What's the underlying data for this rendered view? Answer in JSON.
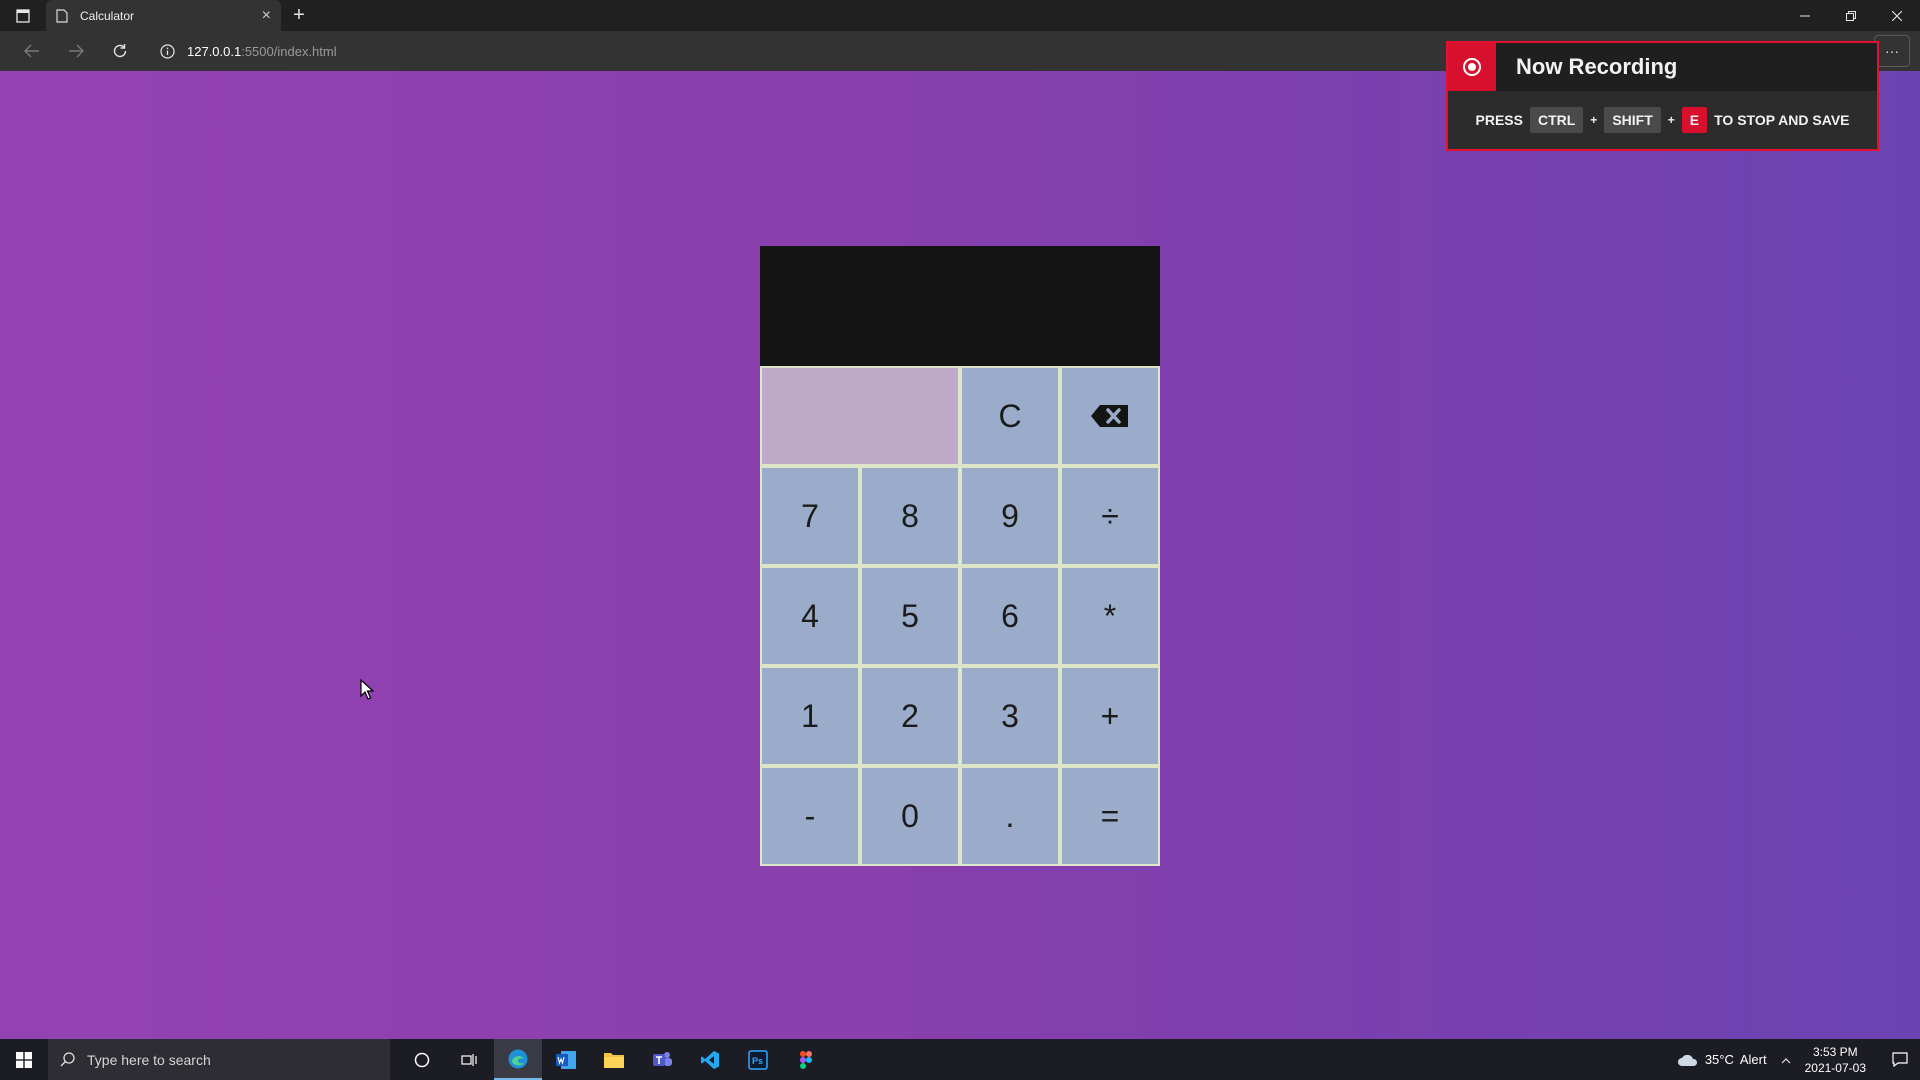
{
  "browser": {
    "tab_title": "Calculator",
    "tab_close": "×",
    "new_tab": "+",
    "url_host": "127.0.0.1",
    "url_path": ":5500/index.html",
    "more": "···"
  },
  "calculator": {
    "previous_operand": "",
    "current_operand": "",
    "keys": {
      "clear": "C",
      "seven": "7",
      "eight": "8",
      "nine": "9",
      "divide": "÷",
      "four": "4",
      "five": "5",
      "six": "6",
      "multiply": "*",
      "one": "1",
      "two": "2",
      "three": "3",
      "add": "+",
      "subtract": "-",
      "zero": "0",
      "decimal": ".",
      "equals": "="
    }
  },
  "recording": {
    "title": "Now Recording",
    "press": "PRESS",
    "key1": "CTRL",
    "key2": "SHIFT",
    "key3": "E",
    "plus": "+",
    "suffix": "TO STOP AND SAVE"
  },
  "taskbar": {
    "search_placeholder": "Type here to search",
    "weather_temp": "35°C",
    "weather_alert": "Alert",
    "time": "3:53 PM",
    "date": "2021-07-03"
  },
  "colors": {
    "background_left": "#9342b3",
    "background_right": "#6c44b2",
    "display_bg": "#141414",
    "key_bg": "#9aacc9",
    "key_border": "#dde6c8",
    "blank_cell_bg": "#bea9c8",
    "recording_accent": "#d80f2d"
  }
}
